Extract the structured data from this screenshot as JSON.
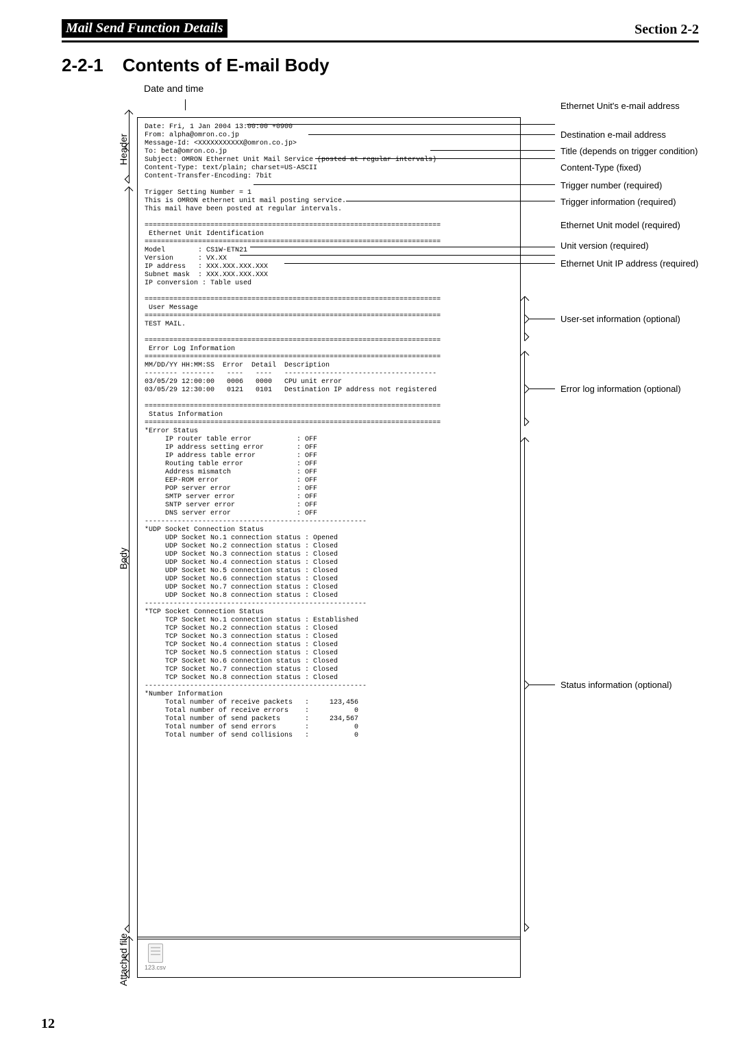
{
  "runningHead": {
    "left": "Mail Send Function Details",
    "right": "Section 2-2"
  },
  "heading": {
    "num": "2-2-1",
    "title": "Contents of E-mail Body"
  },
  "caption": "Date and time",
  "sideLabels": {
    "header": "Header",
    "body": "Body",
    "attached": "Attached file"
  },
  "attachFile": "123.csv",
  "email": "Date: Fri, 1 Jan 2004 13:00:00 +0900\nFrom: alpha@omron.co.jp\nMessage-Id: <XXXXXXXXXXX@omron.co.jp>\nTo: beta@omron.co.jp\nSubject: OMRON Ethernet Unit Mail Service (posted at regular intervals)\nContent-Type: text/plain; charset=US-ASCII\nContent-Transfer-Encoding: 7bit\n\nTrigger Setting Number = 1\nThis is OMRON ethernet unit mail posting service.\nThis mail have been posted at regular intervals.\n\n========================================================================\n Ethernet Unit Identification\n========================================================================\nModel        : CS1W-ETN21\nVersion      : VX.XX\nIP address   : XXX.XXX.XXX.XXX\nSubnet mask  : XXX.XXX.XXX.XXX\nIP conversion : Table used\n\n========================================================================\n User Message\n========================================================================\nTEST MAIL.\n\n========================================================================\n Error Log Information\n========================================================================\nMM/DD/YY HH:MM:SS  Error  Detail  Description\n-------- --------   ----   ----   -------------------------------------\n03/05/29 12:00:00   0006   0000   CPU unit error\n03/05/29 12:30:00   0121   0101   Destination IP address not registered\n\n========================================================================\n Status Information\n========================================================================\n*Error Status\n     IP router table error           : OFF\n     IP address setting error        : OFF\n     IP address table error          : OFF\n     Routing table error             : OFF\n     Address mismatch                : OFF\n     EEP-ROM error                   : OFF\n     POP server error                : OFF\n     SMTP server error               : OFF\n     SNTP server error               : OFF\n     DNS server error                : OFF\n------------------------------------------------------\n*UDP Socket Connection Status\n     UDP Socket No.1 connection status : Opened\n     UDP Socket No.2 connection status : Closed\n     UDP Socket No.3 connection status : Closed\n     UDP Socket No.4 connection status : Closed\n     UDP Socket No.5 connection status : Closed\n     UDP Socket No.6 connection status : Closed\n     UDP Socket No.7 connection status : Closed\n     UDP Socket No.8 connection status : Closed\n------------------------------------------------------\n*TCP Socket Connection Status\n     TCP Socket No.1 connection status : Established\n     TCP Socket No.2 connection status : Closed\n     TCP Socket No.3 connection status : Closed\n     TCP Socket No.4 connection status : Closed\n     TCP Socket No.5 connection status : Closed\n     TCP Socket No.6 connection status : Closed\n     TCP Socket No.7 connection status : Closed\n     TCP Socket No.8 connection status : Closed\n------------------------------------------------------\n*Number Information\n     Total number of receive packets   :     123,456\n     Total number of receive errors    :           0\n     Total number of send packets      :     234,567\n     Total number of send errors       :           0\n     Total number of send collisions   :           0",
  "callouts": {
    "c1": "Ethernet Unit's e-mail address",
    "c2": "Destination e-mail address",
    "c3": "Title (depends on trigger condition)",
    "c4": "Content-Type (fixed)",
    "c5": "Trigger number (required)",
    "c6": "Trigger information (required)",
    "c7": "Ethernet Unit model (required)",
    "c8": "Unit version (required)",
    "c9": "Ethernet Unit IP address (required)",
    "c10": "User-set information (optional)",
    "c11": "Error log information (optional)",
    "c12": "Status information (optional)"
  },
  "pageNumber": "12"
}
